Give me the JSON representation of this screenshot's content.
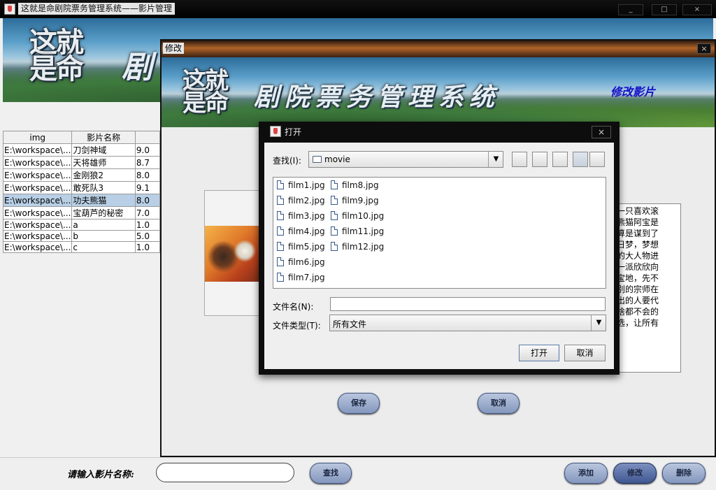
{
  "main_window": {
    "title": "这就是命剧院票务管理系统——影片管理",
    "controls": [
      "_",
      "□",
      "×"
    ],
    "banner_logo": [
      "这就",
      "是命"
    ],
    "banner_title_char": "剧"
  },
  "film_table": {
    "columns": [
      "img",
      "影片名称",
      ""
    ],
    "rows": [
      {
        "img": "E:\\workspace\\...",
        "name": "刀剑神域",
        "score": "9.0"
      },
      {
        "img": "E:\\workspace\\...",
        "name": "天将雄师",
        "score": "8.7"
      },
      {
        "img": "E:\\workspace\\...",
        "name": "金刚狼2",
        "score": "8.0"
      },
      {
        "img": "E:\\workspace\\...",
        "name": "敢死队3",
        "score": "9.1"
      },
      {
        "img": "E:\\workspace\\...",
        "name": "功夫熊猫",
        "score": "8.0"
      },
      {
        "img": "E:\\workspace\\...",
        "name": "宝葫芦的秘密",
        "score": "7.0"
      },
      {
        "img": "E:\\workspace\\...",
        "name": "a",
        "score": "1.0"
      },
      {
        "img": "E:\\workspace\\...",
        "name": "b",
        "score": "5.0"
      },
      {
        "img": "E:\\workspace\\...",
        "name": "c",
        "score": "1.0"
      }
    ],
    "selected_index": 4
  },
  "bottom_bar": {
    "search_label": "请输入影片名称:",
    "search_value": "",
    "search_button": "查找",
    "add_button": "添加",
    "edit_button": "修改",
    "delete_button": "删除"
  },
  "edit_window": {
    "title": "修改",
    "close": "×",
    "banner_logo": [
      "这就",
      "是命"
    ],
    "banner_title": "剧院票务管理系统",
    "banner_subtitle": "修改影片",
    "description_lines": [
      "要从一只喜欢滚",
      "话说熊猫阿宝是",
      "勉强算是谋到了",
      "着白日梦，梦想",
      "星级的大人物进",
      "平谷一派欣欣向",
      "风水宝地，先不",
      "师级别的宗师在",
      "上胜出的人要代",
      "去，啥都不会的",
      "雀中选，让所有"
    ],
    "save_button": "保存",
    "cancel_button": "取消"
  },
  "open_dialog": {
    "title": "打开",
    "close": "×",
    "lookin_label": "查找(I):",
    "lookin_value": "movie",
    "files_col1": [
      "film1.jpg",
      "film2.jpg",
      "film3.jpg",
      "film4.jpg",
      "film5.jpg",
      "film6.jpg",
      "film7.jpg"
    ],
    "files_col2": [
      "film8.jpg",
      "film9.jpg",
      "film10.jpg",
      "film11.jpg",
      "film12.jpg"
    ],
    "filename_label": "文件名(N):",
    "filename_value": "",
    "filetype_label": "文件类型(T):",
    "filetype_value": "所有文件",
    "open_button": "打开",
    "cancel_button": "取消"
  }
}
